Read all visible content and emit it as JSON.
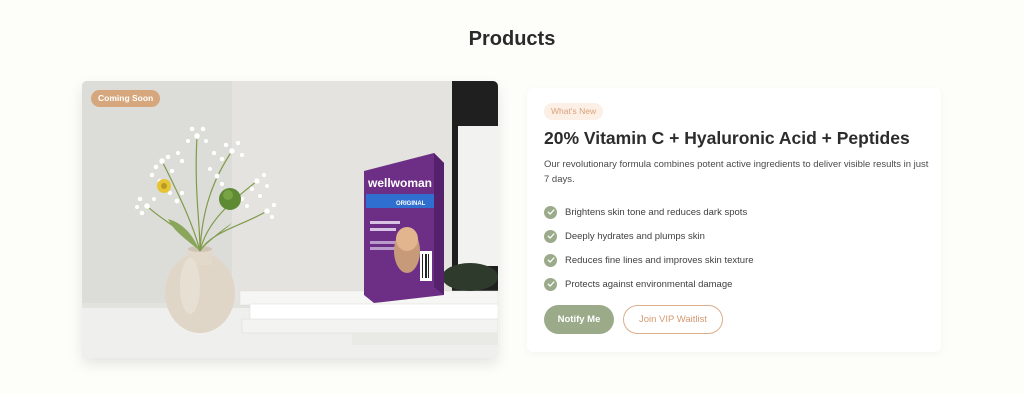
{
  "section": {
    "title": "Products"
  },
  "product": {
    "badge": "Coming Soon",
    "tag": "What's New",
    "title": "20% Vitamin C + Hyaluronic Acid + Peptides",
    "description": "Our revolutionary formula combines potent active ingredients to deliver visible results in just 7 days.",
    "features": [
      "Brightens skin tone and reduces dark spots",
      "Deeply hydrates and plumps skin",
      "Reduces fine lines and improves skin texture",
      "Protects against environmental damage"
    ],
    "image": {
      "box_brand": "wellwoman",
      "box_subtitle": "ORIGINAL"
    },
    "buttons": {
      "notify": "Notify Me",
      "waitlist": "Join VIP Waitlist"
    }
  },
  "colors": {
    "background": "#fdfdf9",
    "accent_green": "#9bab8a",
    "accent_peach": "#d6a77c",
    "text_dark": "#2c2c2c"
  }
}
